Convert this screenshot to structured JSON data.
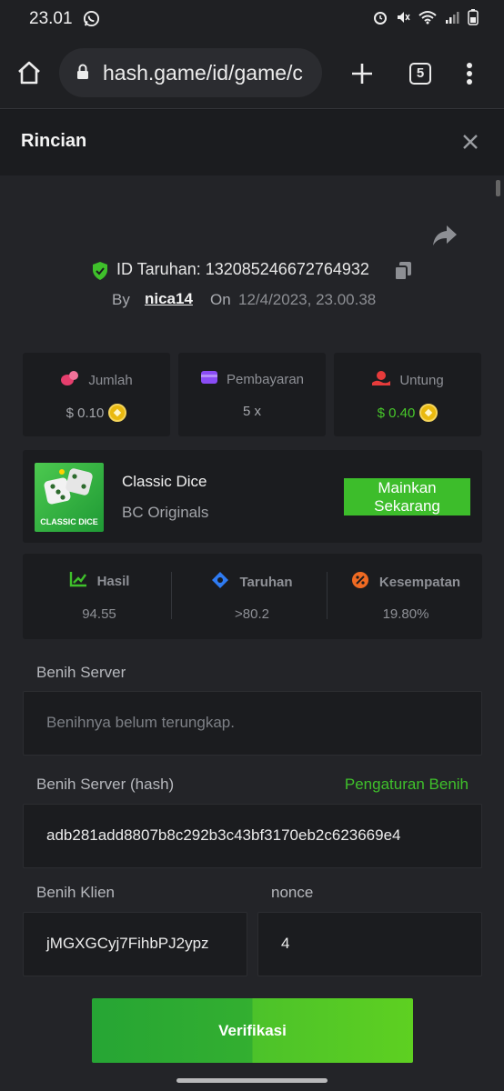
{
  "status_bar": {
    "time": "23.01"
  },
  "browser": {
    "url": "hash.game/id/game/c",
    "tab_count": "5"
  },
  "modal": {
    "title": "Rincian"
  },
  "bet": {
    "id_label": "ID Taruhan: 132085246672764932",
    "by_label": "By",
    "user": "nica14",
    "on_label": "On",
    "date": "12/4/2023, 23.00.38"
  },
  "stats": [
    {
      "label": "Jumlah",
      "value": "$ 0.10"
    },
    {
      "label": "Pembayaran",
      "value": "5 x"
    },
    {
      "label": "Untung",
      "value": "$ 0.40"
    }
  ],
  "game": {
    "thumb_label": "CLASSIC DICE",
    "title": "Classic Dice",
    "provider": "BC Originals",
    "play_label_1": "Mainkan",
    "play_label_2": "Sekarang"
  },
  "results": [
    {
      "label": "Hasil",
      "value": "94.55"
    },
    {
      "label": "Taruhan",
      "value": ">80.2"
    },
    {
      "label": "Kesempatan",
      "value": "19.80%"
    }
  ],
  "fairness": {
    "server_seed_label": "Benih Server",
    "server_seed_placeholder": "Benihnya belum terungkap.",
    "server_hash_label": "Benih Server (hash)",
    "seed_settings_link": "Pengaturan Benih",
    "server_hash_value": "adb281add8807b8c292b3c43bf3170eb2c623669e4",
    "client_seed_label": "Benih Klien",
    "client_seed_value": "jMGXGCyj7FihbPJ2ypz",
    "nonce_label": "nonce",
    "nonce_value": "4",
    "verify_label": "Verifikasi"
  },
  "colors": {
    "accent_green": "#3fc02b",
    "profit_green": "#47c82a",
    "coin_gold": "#e9b90f"
  }
}
